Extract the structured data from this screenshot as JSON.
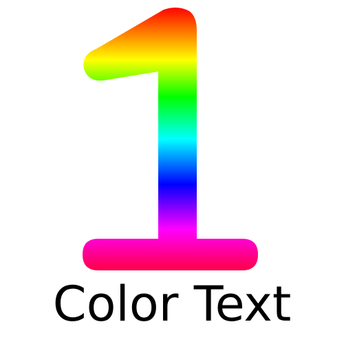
{
  "graphic": {
    "digit": "1",
    "gradient_colors": [
      "#ff0000",
      "#ffff00",
      "#00ff00",
      "#00ffff",
      "#0000ff",
      "#ff00ff",
      "#ff0000"
    ],
    "background": "#ffffff"
  },
  "caption": {
    "text": "Color Text",
    "color": "#000000"
  }
}
